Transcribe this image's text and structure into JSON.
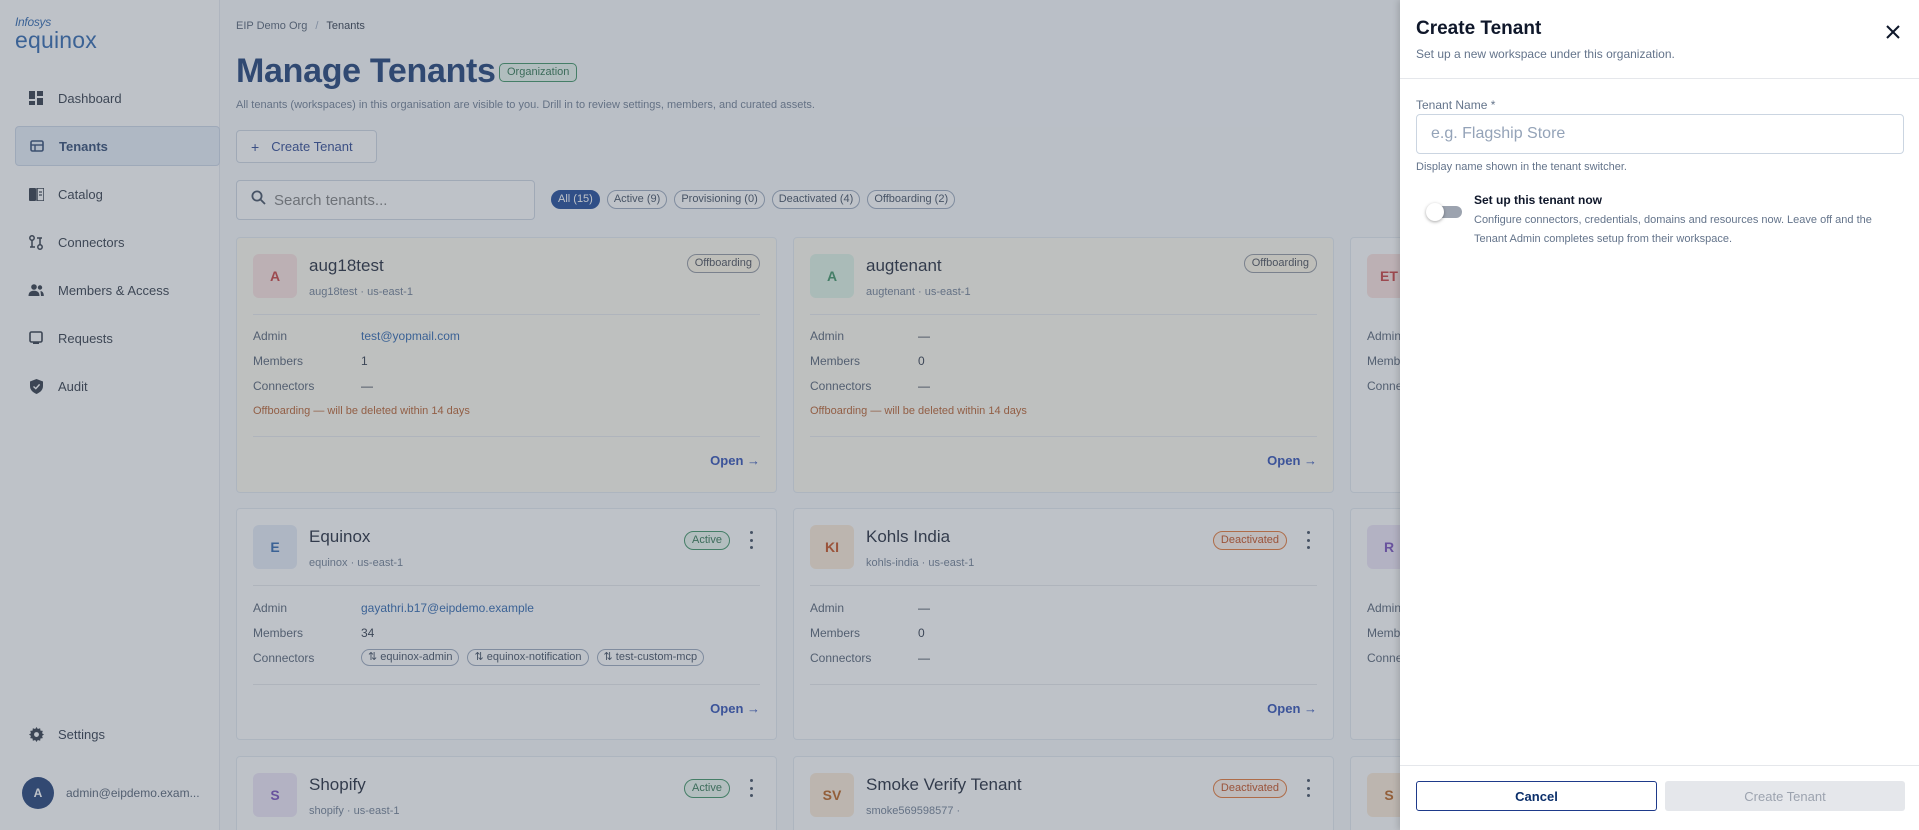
{
  "app": {
    "logo_top": "Infosys",
    "logo_bottom": "equinox"
  },
  "sidebar": {
    "items": [
      {
        "label": "Dashboard",
        "icon": "dashboard-icon"
      },
      {
        "label": "Tenants",
        "icon": "tenants-icon",
        "active": true
      },
      {
        "label": "Catalog",
        "icon": "catalog-icon"
      },
      {
        "label": "Connectors",
        "icon": "connectors-icon"
      },
      {
        "label": "Members & Access",
        "icon": "members-icon"
      },
      {
        "label": "Requests",
        "icon": "requests-icon"
      },
      {
        "label": "Audit",
        "icon": "shield-icon"
      }
    ],
    "settings_label": "Settings",
    "user_initial": "A",
    "user_email": "admin@eipdemo.exam..."
  },
  "header": {
    "breadcrumb": [
      "EIP Demo Org",
      "Tenants"
    ],
    "title": "Manage Tenants",
    "badge": "Organization",
    "subtitle": "All tenants (workspaces) in this organisation are visible to you. Drill in to review settings, members, and curated assets.",
    "create_button": "Create Tenant",
    "search_placeholder": "Search tenants..."
  },
  "filters": [
    {
      "label": "All (15)",
      "active": true
    },
    {
      "label": "Active (9)"
    },
    {
      "label": "Provisioning (0)"
    },
    {
      "label": "Deactivated (4)"
    },
    {
      "label": "Offboarding (2)"
    }
  ],
  "cards": [
    {
      "initials": "A",
      "name": "aug18test",
      "sub": "aug18test · us-east-1",
      "status": "Offboarding",
      "admin_label": "Admin",
      "admin": "test@yopmail.com",
      "members_label": "Members",
      "members": "1",
      "connectors_label": "Connectors",
      "connectors": "—",
      "warning": "Offboarding — will be deleted within 14 days",
      "open": "Open →"
    },
    {
      "initials": "A",
      "name": "augtenant",
      "sub": "augtenant · us-east-1",
      "status": "Offboarding",
      "admin_label": "Admin",
      "admin": "—",
      "members_label": "Members",
      "members": "0",
      "connectors_label": "Connectors",
      "connectors": "—",
      "warning": "Offboarding — will be deleted within 14 days",
      "open": "Open →"
    },
    {
      "initials": "ET",
      "admin_label": "Admin",
      "members_label": "Memb",
      "connectors_label": "Conne"
    },
    {
      "initials": "E",
      "name": "Equinox",
      "sub": "equinox · us-east-1",
      "status": "Active",
      "admin_label": "Admin",
      "admin": "gayathri.b17@eipdemo.example",
      "members_label": "Members",
      "members": "34",
      "connectors_label": "Connectors",
      "connector_chips": [
        "equinox-admin",
        "equinox-notification",
        "test-custom-mcp"
      ],
      "open": "Open →"
    },
    {
      "initials": "KI",
      "name": "Kohls India",
      "sub": "kohls-india · us-east-1",
      "status": "Deactivated",
      "admin_label": "Admin",
      "admin": "—",
      "members_label": "Members",
      "members": "0",
      "connectors_label": "Connectors",
      "connectors": "—",
      "open": "Open →"
    },
    {
      "initials": "R",
      "admin_label": "Admin",
      "members_label": "Memb",
      "connectors_label": "Conne"
    },
    {
      "initials": "S",
      "name": "Shopify",
      "sub": "shopify · us-east-1",
      "status": "Active"
    },
    {
      "initials": "SV",
      "name": "Smoke Verify Tenant",
      "sub": "smoke569598577 ·",
      "status": "Deactivated"
    },
    {
      "initials": "S"
    }
  ],
  "drawer": {
    "title": "Create Tenant",
    "subtitle": "Set up a new workspace under this organization.",
    "name_label": "Tenant Name *",
    "name_placeholder": "e.g. Flagship Store",
    "name_help": "Display name shown in the tenant switcher.",
    "toggle_title": "Set up this tenant now",
    "toggle_desc": "Configure connectors, credentials, domains and resources now. Leave off and the Tenant Admin completes setup from their workspace.",
    "toggle_on": false,
    "cancel": "Cancel",
    "submit": "Create Tenant"
  },
  "colors": {
    "primary": "#0b2f6b",
    "link": "#1e5aa8",
    "active_green": "#2f8b58",
    "deactivated_orange": "#e36c25",
    "warning_text": "#b3541e"
  }
}
